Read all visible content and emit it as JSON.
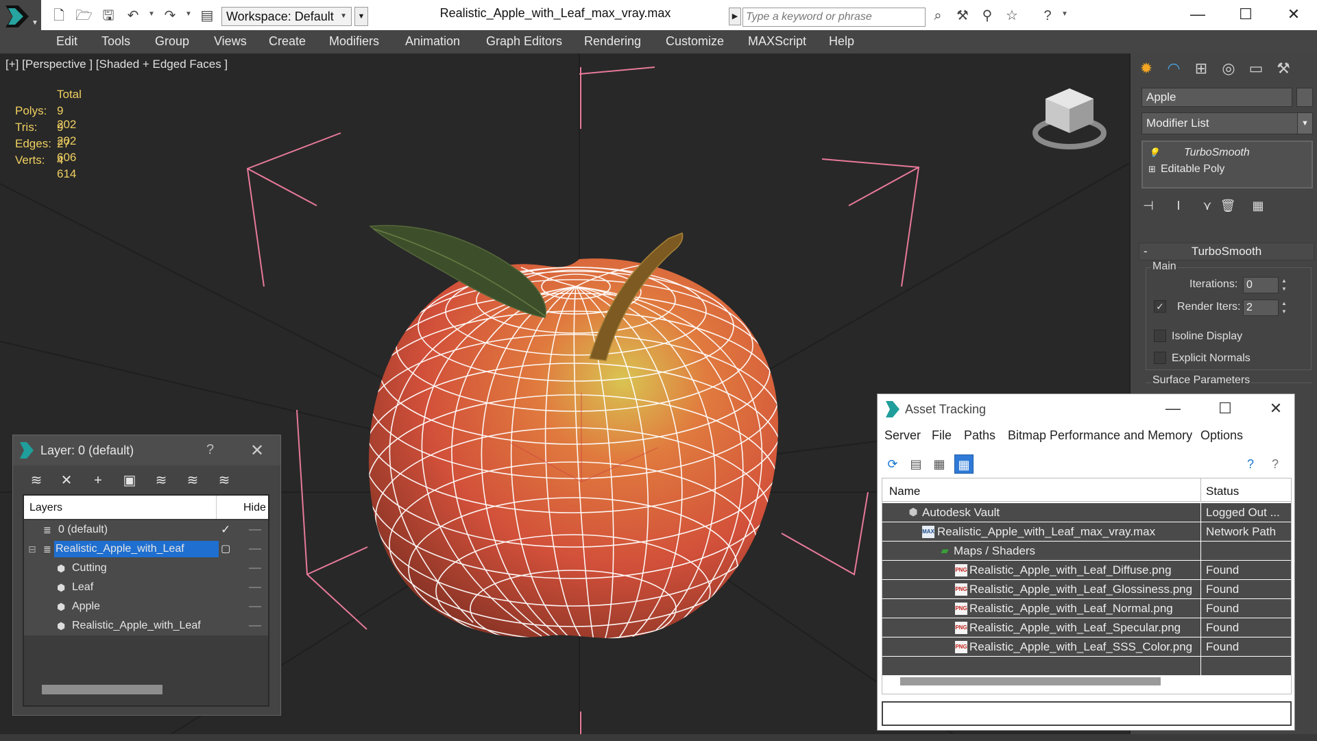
{
  "titlebar": {
    "workspace_label": "Workspace: Default",
    "file_title": "Realistic_Apple_with_Leaf_max_vray.max",
    "search_placeholder": "Type a keyword or phrase",
    "icons": [
      "new-file-icon",
      "open-file-icon",
      "save-icon",
      "undo-icon",
      "redo-icon",
      "project-icon",
      "binoculars-icon",
      "tools-icon",
      "sign-in-icon",
      "favorites-star-icon",
      "help-icon"
    ],
    "window_controls": {
      "minimize": "—",
      "maximize": "☐",
      "close": "✕"
    }
  },
  "menubar": {
    "items": [
      "Edit",
      "Tools",
      "Group",
      "Views",
      "Create",
      "Modifiers",
      "Animation",
      "Graph Editors",
      "Rendering",
      "Customize",
      "MAXScript",
      "Help"
    ]
  },
  "viewport": {
    "label": "[+] [Perspective ] [Shaded + Edged Faces ]",
    "stats": {
      "header": "Total",
      "rows": [
        {
          "key": "Polys:",
          "value": "9 202"
        },
        {
          "key": "Tris:",
          "value": "9 202"
        },
        {
          "key": "Edges:",
          "value": "27 606"
        },
        {
          "key": "Verts:",
          "value": "4 614"
        }
      ]
    },
    "colors": {
      "stats": "#f0d060",
      "wire": "#ffffff",
      "bbox": "#e87a9a"
    }
  },
  "command_panel": {
    "object_name": "Apple",
    "modifier_list": "Modifier List",
    "stack": [
      "TurboSmooth",
      "Editable Poly"
    ],
    "rollout_title": "TurboSmooth",
    "main_group": "Main",
    "iterations_label": "Iterations:",
    "iterations_value": "0",
    "render_iters_label": "Render Iters:",
    "render_iters_value": "2",
    "render_iters_checked": true,
    "isoline_label": "Isoline Display",
    "explicit_normals_label": "Explicit Normals",
    "surface_params_label": "Surface Parameters"
  },
  "layer_dialog": {
    "title": "Layer: 0 (default)",
    "help": "?",
    "col_layers": "Layers",
    "col_hide": "Hide",
    "rows": [
      {
        "name": "0 (default)",
        "type": "layer",
        "indent": 0
      },
      {
        "name": "Realistic_Apple_with_Leaf",
        "type": "layer",
        "indent": 0,
        "selected": true
      },
      {
        "name": "Cutting",
        "type": "object",
        "indent": 1
      },
      {
        "name": "Leaf",
        "type": "object",
        "indent": 1
      },
      {
        "name": "Apple",
        "type": "object",
        "indent": 1
      },
      {
        "name": "Realistic_Apple_with_Leaf",
        "type": "object",
        "indent": 1
      }
    ]
  },
  "asset_tracking": {
    "title": "Asset Tracking",
    "menus": [
      "Server",
      "File",
      "Paths",
      "Bitmap Performance and Memory",
      "Options"
    ],
    "col_name": "Name",
    "col_status": "Status",
    "rows": [
      {
        "name": "Autodesk Vault",
        "status": "Logged Out ...",
        "icon": "vault",
        "indent": 1
      },
      {
        "name": "Realistic_Apple_with_Leaf_max_vray.max",
        "status": "Network Path",
        "icon": "max",
        "indent": 2
      },
      {
        "name": "Maps / Shaders",
        "status": "",
        "icon": "folder",
        "indent": 3
      },
      {
        "name": "Realistic_Apple_with_Leaf_Diffuse.png",
        "status": "Found",
        "icon": "png",
        "indent": 4
      },
      {
        "name": "Realistic_Apple_with_Leaf_Glossiness.png",
        "status": "Found",
        "icon": "png",
        "indent": 4
      },
      {
        "name": "Realistic_Apple_with_Leaf_Normal.png",
        "status": "Found",
        "icon": "png",
        "indent": 4
      },
      {
        "name": "Realistic_Apple_with_Leaf_Specular.png",
        "status": "Found",
        "icon": "png",
        "indent": 4
      },
      {
        "name": "Realistic_Apple_with_Leaf_SSS_Color.png",
        "status": "Found",
        "icon": "png",
        "indent": 4
      }
    ],
    "icon_labels": {
      "png": "PNG",
      "max": "MAX"
    }
  }
}
